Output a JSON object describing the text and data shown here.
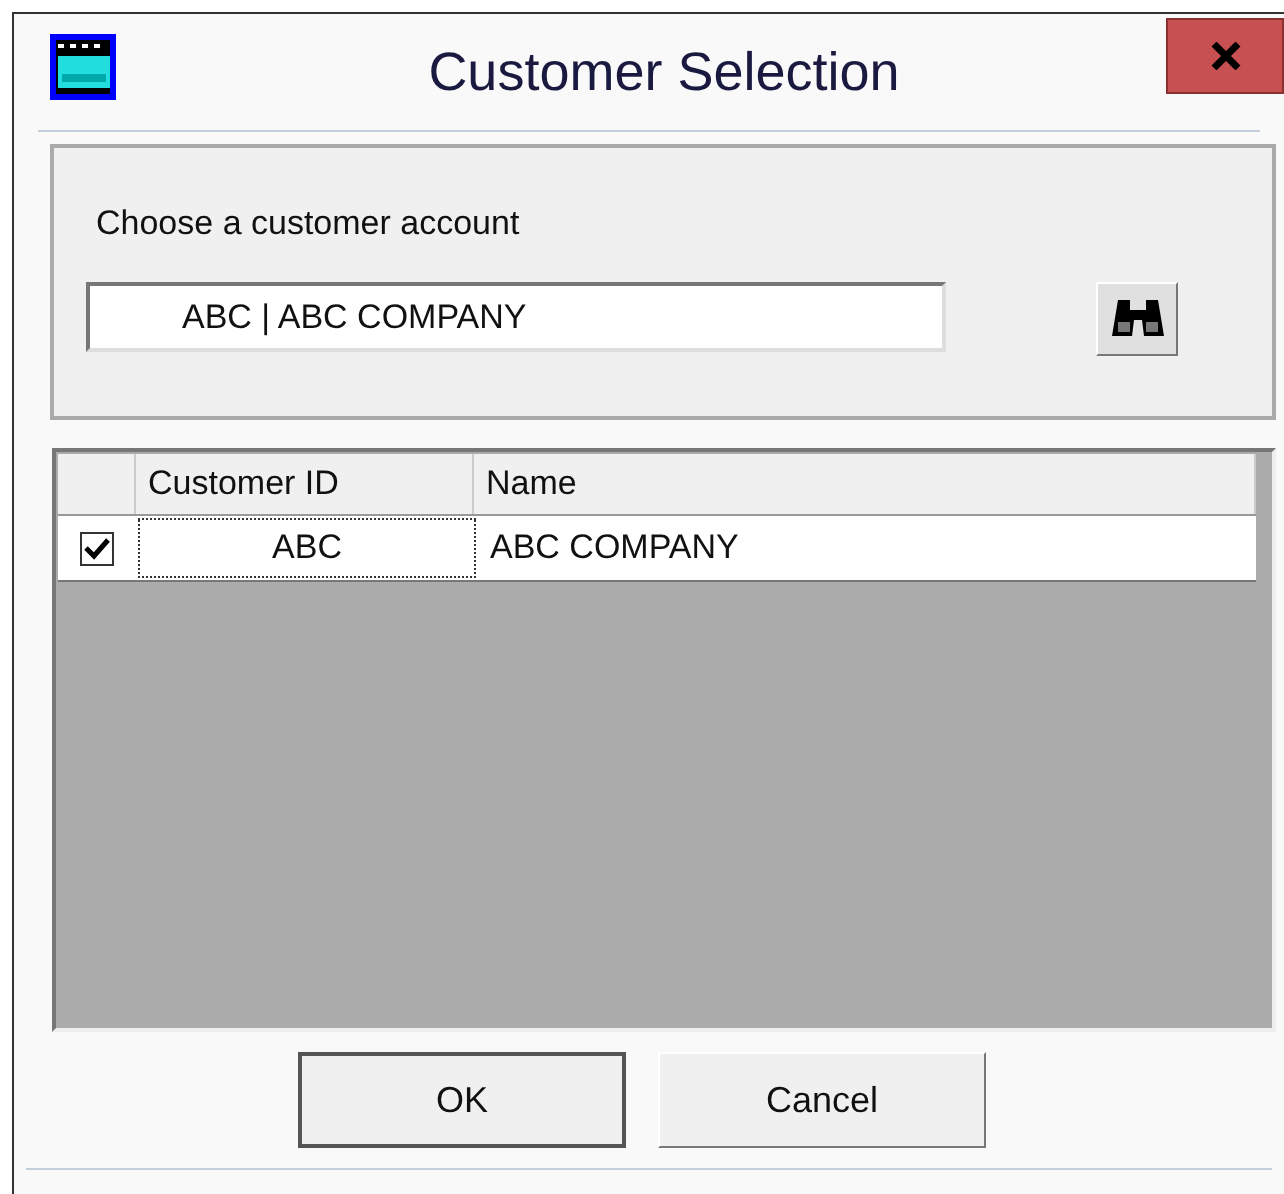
{
  "window": {
    "title": "Customer Selection"
  },
  "prompt": "Choose a customer account",
  "account_field": {
    "value": "ABC | ABC COMPANY"
  },
  "table": {
    "columns": [
      "Customer ID",
      "Name"
    ],
    "rows": [
      {
        "checked": true,
        "cells": [
          "ABC",
          "ABC COMPANY"
        ]
      }
    ]
  },
  "buttons": [
    {
      "label": "OK",
      "default": true
    },
    {
      "label": "Cancel",
      "default": false
    }
  ]
}
